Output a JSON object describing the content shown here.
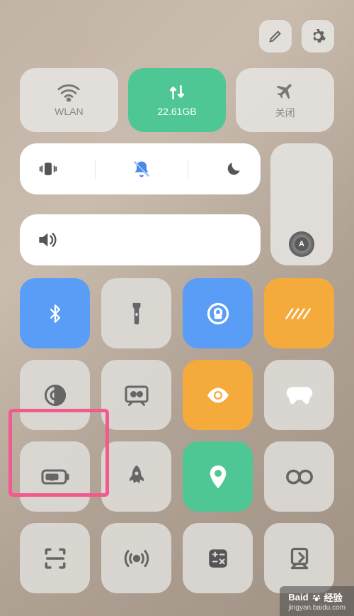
{
  "top": {
    "edit": "edit",
    "settings": "settings"
  },
  "connectivity": {
    "wifi_label": "WLAN",
    "data_label": "22.61GB",
    "airplane_label": "关闭"
  },
  "watermark": {
    "brand": "Baid",
    "suffix": "经验",
    "url": "jingyan.baidu.com"
  },
  "tiles": {
    "bluetooth": "bluetooth",
    "flashlight": "flashlight",
    "rotation_lock": "rotation-lock",
    "multiwindow": "multi-window",
    "dark_mode": "dark-mode",
    "screen_record": "screen-record",
    "eye_comfort": "eye-comfort",
    "game_mode": "game-mode",
    "super_battery": "super-battery",
    "boost": "boost",
    "location": "location",
    "nearby": "nearby",
    "scan": "scan",
    "hotspot": "hotspot",
    "calculator": "calculator",
    "cast": "cast"
  }
}
